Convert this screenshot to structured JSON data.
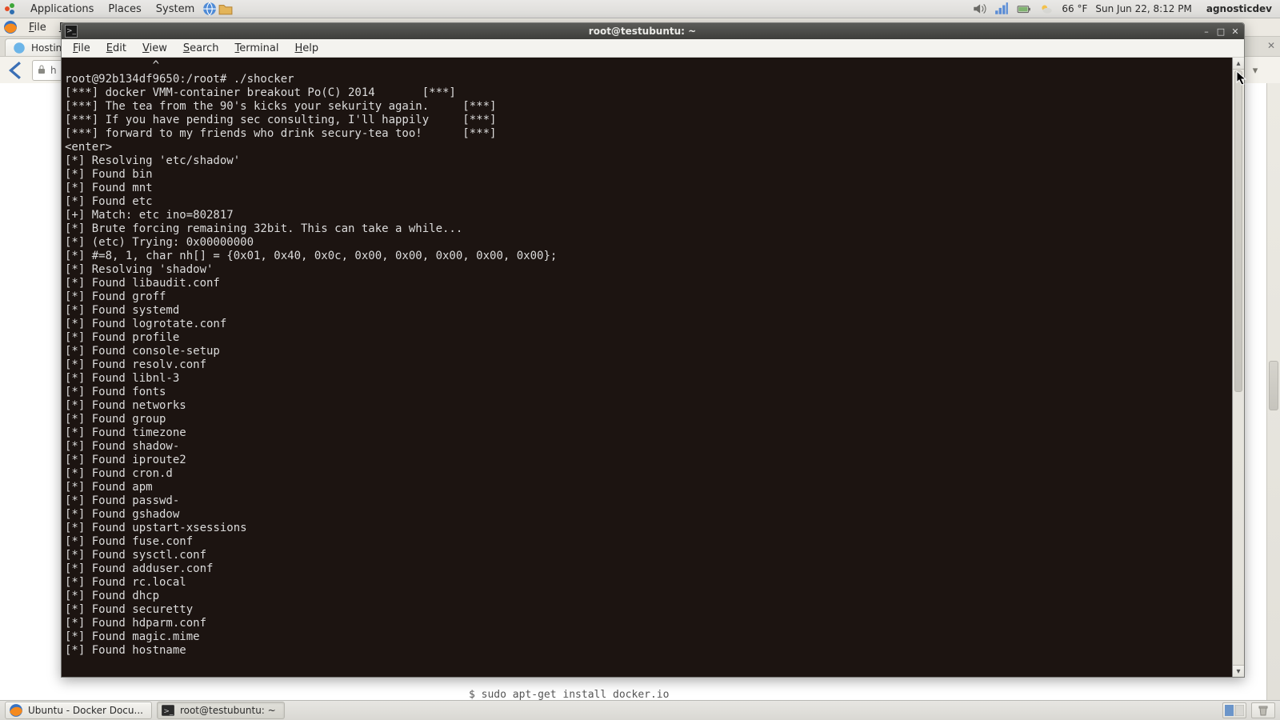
{
  "gnome": {
    "menus": {
      "applications": "Applications",
      "places": "Places",
      "system": "System"
    },
    "weather_temp": "66 °F",
    "clock": "Sun Jun 22,  8:12 PM",
    "user": "agnosticdev"
  },
  "firefox": {
    "menu": {
      "file": "File",
      "edit": "Edit"
    },
    "tab_label": "Hosting",
    "url_fragment": "h"
  },
  "snippet_below": "$  sudo  apt-get  install  docker.io",
  "taskbar": {
    "task1": "Ubuntu - Docker Docu...",
    "task2": "root@testubuntu: ~"
  },
  "terminal": {
    "title": "root@testubuntu: ~",
    "menu": {
      "file": "File",
      "edit": "Edit",
      "view": "View",
      "search": "Search",
      "terminal": "Terminal",
      "help": "Help"
    },
    "lines": [
      "             ^",
      "root@92b134df9650:/root# ./shocker",
      "[***] docker VMM-container breakout Po(C) 2014       [***]",
      "[***] The tea from the 90's kicks your sekurity again.     [***]",
      "[***] If you have pending sec consulting, I'll happily     [***]",
      "[***] forward to my friends who drink secury-tea too!      [***]",
      "",
      "<enter>",
      "",
      "[*] Resolving 'etc/shadow'",
      "[*] Found bin",
      "[*] Found mnt",
      "[*] Found etc",
      "[+] Match: etc ino=802817",
      "[*] Brute forcing remaining 32bit. This can take a while...",
      "[*] (etc) Trying: 0x00000000",
      "[*] #=8, 1, char nh[] = {0x01, 0x40, 0x0c, 0x00, 0x00, 0x00, 0x00, 0x00};",
      "[*] Resolving 'shadow'",
      "[*] Found libaudit.conf",
      "[*] Found groff",
      "[*] Found systemd",
      "[*] Found logrotate.conf",
      "[*] Found profile",
      "[*] Found console-setup",
      "[*] Found resolv.conf",
      "[*] Found libnl-3",
      "[*] Found fonts",
      "[*] Found networks",
      "[*] Found group",
      "[*] Found timezone",
      "[*] Found shadow-",
      "[*] Found iproute2",
      "[*] Found cron.d",
      "[*] Found apm",
      "[*] Found passwd-",
      "[*] Found gshadow",
      "[*] Found upstart-xsessions",
      "[*] Found fuse.conf",
      "[*] Found sysctl.conf",
      "[*] Found adduser.conf",
      "[*] Found rc.local",
      "[*] Found dhcp",
      "[*] Found securetty",
      "[*] Found hdparm.conf",
      "[*] Found magic.mime",
      "[*] Found hostname"
    ]
  }
}
